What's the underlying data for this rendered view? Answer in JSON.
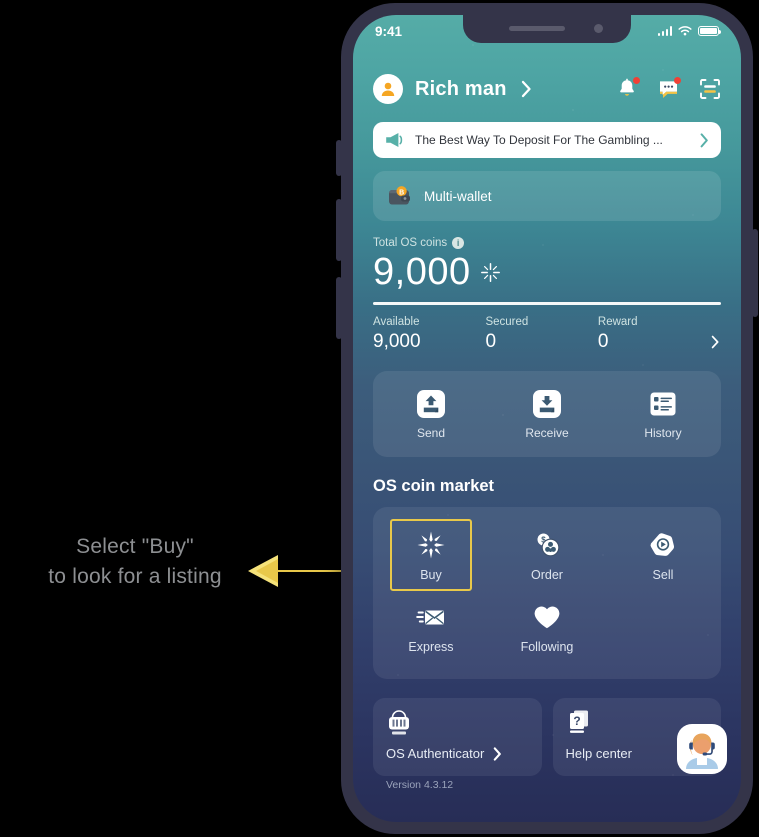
{
  "annotation": {
    "text": "Select \"Buy\"\nto look for a listing",
    "arrow_color": "#e8c84a"
  },
  "status_bar": {
    "time": "9:41",
    "signal_icon": "cellular-bars-icon",
    "wifi_icon": "wifi-icon",
    "battery_icon": "battery-icon"
  },
  "header": {
    "avatar_icon": "user-avatar-icon",
    "username": "Rich man",
    "chevron_icon": "chevron-right-icon",
    "icons": [
      {
        "name": "notification-bell-icon",
        "badge": true
      },
      {
        "name": "messages-icon",
        "badge": true
      },
      {
        "name": "scan-qr-icon",
        "badge": false
      }
    ]
  },
  "banner": {
    "icon": "megaphone-icon",
    "text": "The Best Way To Deposit For The Gambling ...",
    "chevron_icon": "chevron-right-icon"
  },
  "multi_wallet": {
    "icon": "wallet-icon",
    "label": "Multi-wallet"
  },
  "balance": {
    "label": "Total OS coins",
    "info_icon": "info-icon",
    "amount": "9,000",
    "coin_icon": "os-coin-icon",
    "stats": [
      {
        "key": "Available",
        "value": "9,000"
      },
      {
        "key": "Secured",
        "value": "0"
      },
      {
        "key": "Reward",
        "value": "0"
      }
    ],
    "chevron_icon": "chevron-right-icon"
  },
  "actions": [
    {
      "label": "Send",
      "icon": "send-icon"
    },
    {
      "label": "Receive",
      "icon": "receive-icon"
    },
    {
      "label": "History",
      "icon": "history-list-icon"
    }
  ],
  "market": {
    "title": "OS coin market",
    "items": [
      {
        "label": "Buy",
        "icon": "starburst-buy-icon",
        "selected": true
      },
      {
        "label": "Order",
        "icon": "coins-order-icon",
        "selected": false
      },
      {
        "label": "Sell",
        "icon": "sell-badge-icon",
        "selected": false
      },
      {
        "label": "Express",
        "icon": "express-envelope-icon",
        "selected": false
      },
      {
        "label": "Following",
        "icon": "heart-icon",
        "selected": false
      }
    ]
  },
  "bottom": {
    "authenticator": {
      "icon": "authenticator-lock-icon",
      "label": "OS Authenticator",
      "chevron_icon": "chevron-right-icon",
      "version": "Version 4.3.12"
    },
    "help": {
      "icon": "question-book-icon",
      "label": "Help center",
      "support_avatar_icon": "support-agent-icon"
    }
  },
  "colors": {
    "accent_yellow": "#e8c84a",
    "screen_top": "#55aca7",
    "screen_bottom": "#272d56",
    "badge_red": "#ef4136"
  }
}
